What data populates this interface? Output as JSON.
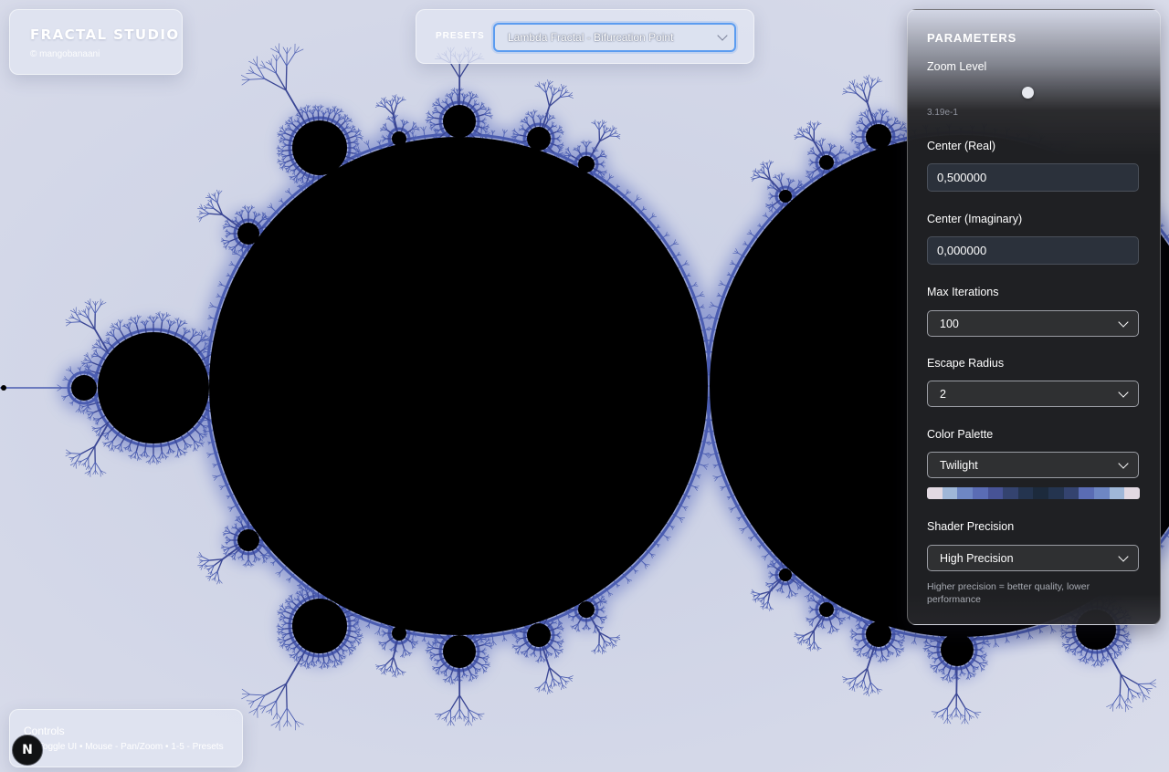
{
  "app": {
    "title": "FRACTAL STUDIO",
    "credit": "© mangobanaani"
  },
  "presets": {
    "label": "PRESETS",
    "selected": "Lambda Fractal - Bifurcation Point"
  },
  "parameters": {
    "title": "PARAMETERS",
    "zoom": {
      "label": "Zoom Level",
      "value": "3.19e-1"
    },
    "center_real": {
      "label": "Center (Real)",
      "value": "0,500000"
    },
    "center_imag": {
      "label": "Center (Imaginary)",
      "value": "0,000000"
    },
    "max_iterations": {
      "label": "Max Iterations",
      "value": "100"
    },
    "escape_radius": {
      "label": "Escape Radius",
      "value": "2"
    },
    "color_palette": {
      "label": "Color Palette",
      "value": "Twilight",
      "swatches": [
        "#e2d9e2",
        "#9fb7d8",
        "#6e87c4",
        "#5a6cb4",
        "#475396",
        "#34436f",
        "#24344f",
        "#1c2a3c",
        "#24344f",
        "#34436f",
        "#5a6cb4",
        "#6e87c4",
        "#9fb7d8",
        "#e2d9e2"
      ]
    },
    "shader_precision": {
      "label": "Shader Precision",
      "value": "High Precision",
      "hint": "Higher precision = better quality, lower performance"
    }
  },
  "controls": {
    "title": "Controls",
    "text": "H - Toggle UI • Mouse - Pan/Zoom • 1-5 - Presets"
  },
  "badge": {
    "letter": "N"
  },
  "colors": {
    "background": "#cdd3e6",
    "fractal_interior": "#000000",
    "fractal_edge": "#4a5cb0",
    "accent_focus": "#5b9cf0",
    "panel_dark": "#1f2023"
  }
}
